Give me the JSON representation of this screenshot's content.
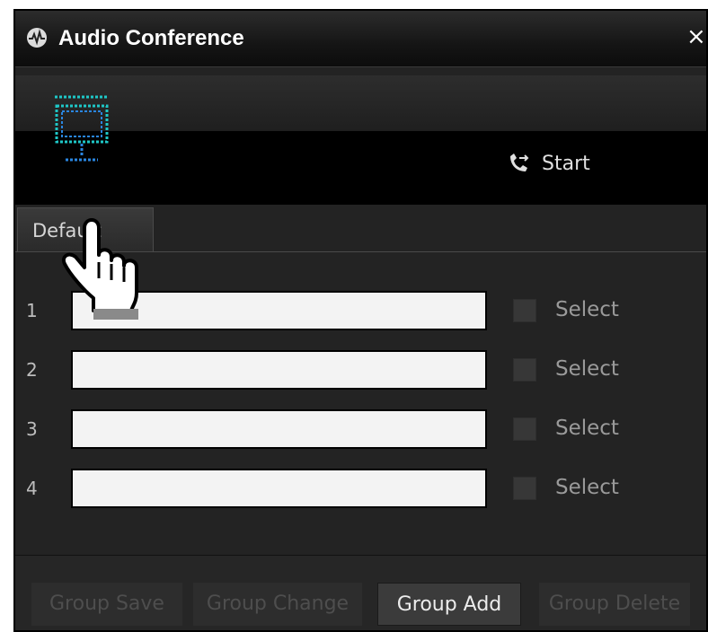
{
  "window": {
    "title": "Audio Conference",
    "close_glyph": "×"
  },
  "toolbar": {
    "start_label": "Start",
    "start_icon": "phone-transfer-icon",
    "monitor_icon": "conference-display-icon"
  },
  "tabs": [
    {
      "label": "Default",
      "active": true
    }
  ],
  "rows": [
    {
      "number": "1",
      "value": "",
      "select_label": "Select",
      "checked": false
    },
    {
      "number": "2",
      "value": "",
      "select_label": "Select",
      "checked": false
    },
    {
      "number": "3",
      "value": "",
      "select_label": "Select",
      "checked": false
    },
    {
      "number": "4",
      "value": "",
      "select_label": "Select",
      "checked": false
    }
  ],
  "buttons": {
    "group_save": {
      "label": "Group Save",
      "enabled": false
    },
    "group_change": {
      "label": "Group Change",
      "enabled": false
    },
    "group_add": {
      "label": "Group Add",
      "enabled": true
    },
    "group_delete": {
      "label": "Group Delete",
      "enabled": false
    }
  },
  "colors": {
    "accent_teal": "#1ec8c8",
    "accent_blue": "#2a86e0",
    "panel_bg": "#232323"
  }
}
